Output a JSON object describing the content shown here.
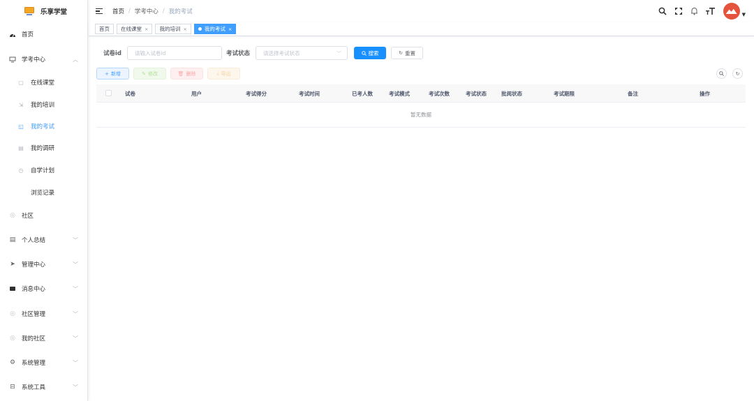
{
  "app": {
    "title": "乐享学堂"
  },
  "sidebar": {
    "home": "首页",
    "study_center": "学考中心",
    "sub_items": [
      "在线课堂",
      "我的培训",
      "我的考试",
      "我的调研",
      "自学计划",
      "浏览记录"
    ],
    "active_sub": "我的考试",
    "groups": [
      "社区",
      "个人总结",
      "管理中心",
      "消息中心",
      "社区管理",
      "我的社区",
      "系统管理",
      "系统工具"
    ]
  },
  "breadcrumb": [
    "首页",
    "学考中心",
    "我的考试"
  ],
  "tags": [
    {
      "label": "首页",
      "closable": false,
      "active": false
    },
    {
      "label": "在线课堂",
      "closable": true,
      "active": false
    },
    {
      "label": "我的培训",
      "closable": true,
      "active": false
    },
    {
      "label": "我的考试",
      "closable": true,
      "active": true
    }
  ],
  "search": {
    "paper_id_label": "试卷id",
    "paper_id_placeholder": "请输入试卷id",
    "status_label": "考试状态",
    "status_placeholder": "请选择考试状态",
    "search_btn": "搜索",
    "reset_btn": "重置"
  },
  "actions": {
    "add": "新增",
    "edit": "修改",
    "delete": "删除",
    "export": "导出"
  },
  "table": {
    "columns": [
      "试卷",
      "用户",
      "考试得分",
      "考试时间",
      "已考人数",
      "考试模式",
      "考试次数",
      "考试状态",
      "批阅状态",
      "考试期限",
      "备注",
      "操作"
    ],
    "empty_text": "暂无数据"
  },
  "colors": {
    "primary": "#1890ff",
    "active_menu": "#409eff",
    "avatar": "#e5533c"
  }
}
